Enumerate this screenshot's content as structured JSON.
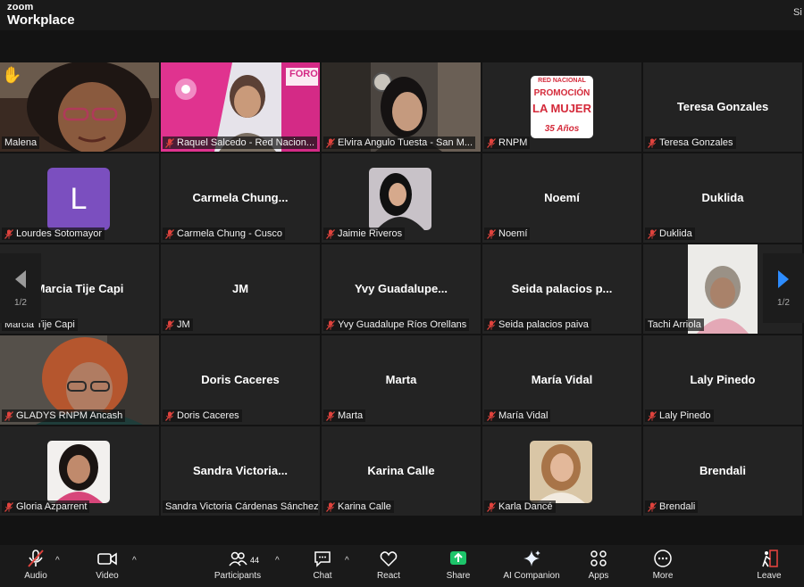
{
  "app": {
    "brand_line1": "zoom",
    "brand_line2": "Workplace",
    "top_right_text": "Si"
  },
  "pagination": {
    "left_page": "1/2",
    "right_page": "1/2"
  },
  "tiles": [
    {
      "label": "Malena",
      "big": "",
      "muted": false
    },
    {
      "label": "Raquel Salcedo - Red Nacion...",
      "big": "",
      "muted": true
    },
    {
      "label": "Elvira Angulo Tuesta - San M...",
      "big": "",
      "muted": true
    },
    {
      "label": "RNPM",
      "big": "",
      "muted": true
    },
    {
      "label": "Teresa Gonzales",
      "big": "Teresa Gonzales",
      "muted": true
    },
    {
      "label": "Lourdes Sotomayor",
      "big": "",
      "muted": true,
      "initial": "L"
    },
    {
      "label": "Carmela Chung - Cusco",
      "big": "Carmela  Chung...",
      "muted": true
    },
    {
      "label": "Jaimie Riveros",
      "big": "",
      "muted": true
    },
    {
      "label": "Noemí",
      "big": "Noemí",
      "muted": true
    },
    {
      "label": "Duklida",
      "big": "Duklida",
      "muted": true
    },
    {
      "label": "Marcia Tije Capi",
      "big": "Marcia Tije Capi",
      "muted": false
    },
    {
      "label": "JM",
      "big": "JM",
      "muted": true
    },
    {
      "label": "Yvy Guadalupe Ríos Orellans",
      "big": "Yvy  Guadalupe...",
      "muted": true
    },
    {
      "label": "Seida palacios paiva",
      "big": "Seida  palacios  p...",
      "muted": true
    },
    {
      "label": "Tachi Arriola",
      "big": "",
      "muted": false
    },
    {
      "label": "GLADYS RNPM Ancash",
      "big": "",
      "muted": true
    },
    {
      "label": "Doris Caceres",
      "big": "Doris Caceres",
      "muted": true
    },
    {
      "label": "Marta",
      "big": "Marta",
      "muted": true
    },
    {
      "label": "María Vidal",
      "big": "María Vidal",
      "muted": true
    },
    {
      "label": "Laly Pinedo",
      "big": "Laly Pinedo",
      "muted": true
    },
    {
      "label": "Gloria Azparrent",
      "big": "",
      "muted": true
    },
    {
      "label": "Sandra Victoria Cárdenas Sánchez",
      "big": "Sandra  Victoria...",
      "muted": false
    },
    {
      "label": "Karina Calle",
      "big": "Karina Calle",
      "muted": true
    },
    {
      "label": "Karla Dancé",
      "big": "",
      "muted": true
    },
    {
      "label": "Brendali",
      "big": "Brendali",
      "muted": true
    }
  ],
  "poster": {
    "line1": "RED NACIONAL",
    "line2": "PROMOCIÓN",
    "line3": "LA MUJER",
    "line4": "35 Años"
  },
  "banner": {
    "text": "FORO"
  },
  "toolbar": {
    "audio": "Audio",
    "video": "Video",
    "participants": "Participants",
    "participants_count": "44",
    "chat": "Chat",
    "react": "React",
    "share": "Share",
    "ai": "AI Companion",
    "apps": "Apps",
    "more": "More",
    "leave": "Leave"
  },
  "colors": {
    "active_border": "#37c47e",
    "muted_red": "#e0433d",
    "share_green": "#1dc46a",
    "nav_arrow": "#2d8cff"
  }
}
